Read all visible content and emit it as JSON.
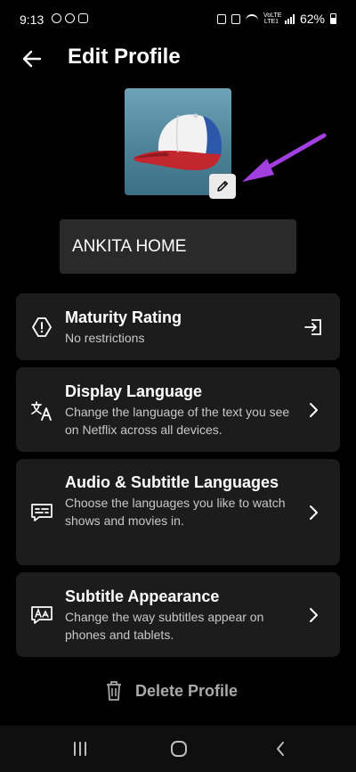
{
  "status_bar": {
    "time": "9:13",
    "volte": "VoLTE LTE1",
    "battery_percent": "62%"
  },
  "header": {
    "title": "Edit Profile"
  },
  "profile": {
    "name": "ANKITA HOME"
  },
  "settings": [
    {
      "title": "Maturity Rating",
      "subtitle": "No restrictions",
      "icon": "alert-hexagon-icon",
      "trailing": "open-external-icon"
    },
    {
      "title": "Display Language",
      "subtitle": "Change the language of the text you see on Netflix across all devices.",
      "icon": "translate-icon",
      "trailing": "chevron-right-icon"
    },
    {
      "title": "Audio & Subtitle Languages",
      "subtitle": "Choose the languages you like to watch shows and movies in.",
      "icon": "subtitles-icon",
      "trailing": "chevron-right-icon"
    },
    {
      "title": "Subtitle Appearance",
      "subtitle": "Change the way subtitles appear on phones and tablets.",
      "icon": "subtitle-style-icon",
      "trailing": "chevron-right-icon"
    }
  ],
  "delete_label": "Delete Profile",
  "colors": {
    "background": "#000000",
    "card": "#1c1c1c",
    "input": "#2a2a2a",
    "annotation_arrow": "#a23fe0"
  }
}
